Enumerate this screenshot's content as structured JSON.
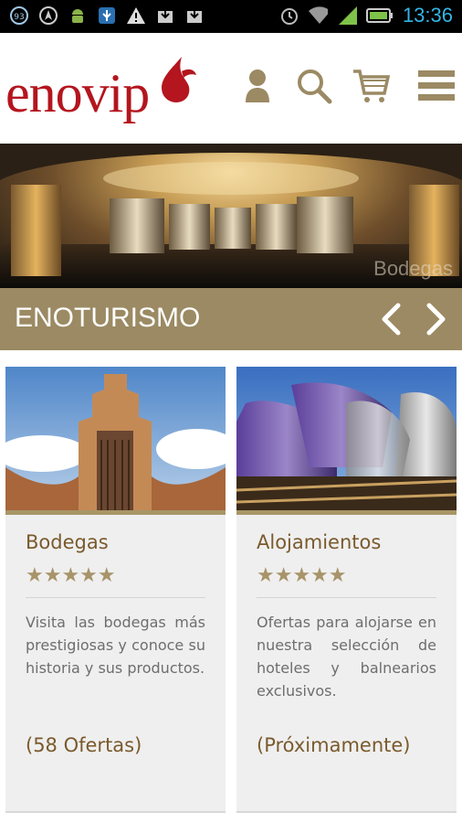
{
  "status_bar": {
    "clock": "13:36",
    "notification_badge": "93",
    "icons": [
      "notification-badge-icon",
      "navigation-icon",
      "android-icon",
      "usb-icon",
      "warning-icon",
      "download-icon",
      "download-icon",
      "alarm-icon",
      "wifi-icon",
      "signal-icon",
      "battery-icon"
    ]
  },
  "header": {
    "logo_text": "enovip",
    "icons": [
      "user-icon",
      "search-icon",
      "cart-icon",
      "menu-icon"
    ]
  },
  "hero": {
    "caption": "Bodegas"
  },
  "section": {
    "title": "ENOTURISMO",
    "prev_icon": "chevron-left-icon",
    "next_icon": "chevron-right-icon"
  },
  "cards": [
    {
      "title": "Bodegas",
      "rating": 5,
      "stars": "★★★★★",
      "description": "Visita las bodegas más prestigiosas y conoce su historia y sus productos.",
      "offers": "(58 Ofertas)"
    },
    {
      "title": "Alojamientos",
      "rating": 5,
      "stars": "★★★★★",
      "description": "Ofertas para alojarse en nuestra selección de hoteles y balnearios exclusivos.",
      "offers": "(Próximamente)"
    }
  ],
  "colors": {
    "brand_red": "#b4151e",
    "accent_gold": "#9b8a63",
    "title_brown": "#7a5a2c",
    "status_blue": "#33b5e5"
  }
}
